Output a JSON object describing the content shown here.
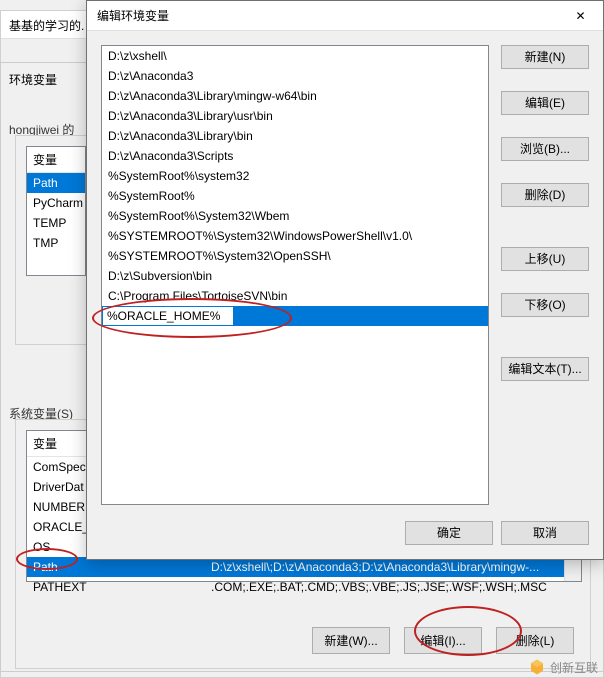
{
  "bg": {
    "parent_title_fragment": "基基的学习的.",
    "env_var_label": "环境变量",
    "user_section_label": "hongjiwei 的",
    "system_section_label": "系统变量(S)",
    "col_variable": "变量",
    "user_vars": [
      "Path",
      "PyCharm",
      "TEMP",
      "TMP"
    ],
    "system_vars": [
      {
        "name": "ComSpec",
        "value": ""
      },
      {
        "name": "DriverDat",
        "value": ""
      },
      {
        "name": "NUMBER",
        "value": ""
      },
      {
        "name": "ORACLE_",
        "value": ""
      },
      {
        "name": "OS",
        "value": ""
      },
      {
        "name": "Path",
        "value": "D:\\z\\xshell\\;D:\\z\\Anaconda3;D:\\z\\Anaconda3\\Library\\mingw-..."
      },
      {
        "name": "PATHEXT",
        "value": ".COM;.EXE;.BAT;.CMD;.VBS;.VBE;.JS;.JSE;.WSF;.WSH;.MSC"
      }
    ],
    "btn_new": "新建(W)...",
    "btn_edit": "编辑(I)...",
    "btn_delete": "删除(L)"
  },
  "modal": {
    "title": "编辑环境变量",
    "paths": [
      "D:\\z\\xshell\\",
      "D:\\z\\Anaconda3",
      "D:\\z\\Anaconda3\\Library\\mingw-w64\\bin",
      "D:\\z\\Anaconda3\\Library\\usr\\bin",
      "D:\\z\\Anaconda3\\Library\\bin",
      "D:\\z\\Anaconda3\\Scripts",
      "%SystemRoot%\\system32",
      "%SystemRoot%",
      "%SystemRoot%\\System32\\Wbem",
      "%SYSTEMROOT%\\System32\\WindowsPowerShell\\v1.0\\",
      "%SYSTEMROOT%\\System32\\OpenSSH\\",
      "D:\\z\\Subversion\\bin",
      "C:\\Program Files\\TortoiseSVN\\bin"
    ],
    "editing_value": "%ORACLE_HOME%",
    "btn_new": "新建(N)",
    "btn_edit": "编辑(E)",
    "btn_browse": "浏览(B)...",
    "btn_delete": "删除(D)",
    "btn_moveup": "上移(U)",
    "btn_movedown": "下移(O)",
    "btn_edittext": "编辑文本(T)...",
    "btn_ok": "确定",
    "btn_cancel": "取消"
  },
  "watermark": {
    "text": "创新互联"
  }
}
